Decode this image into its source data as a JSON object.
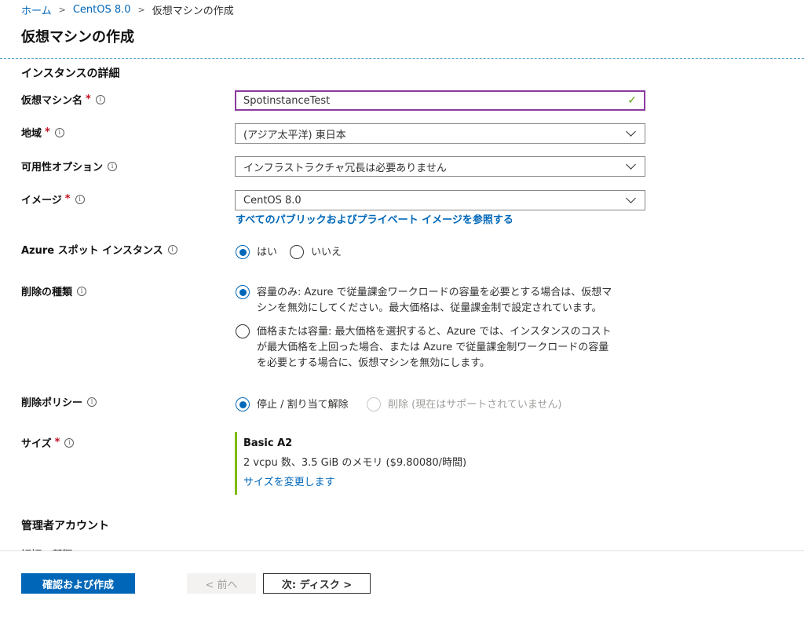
{
  "breadcrumb": {
    "home": "ホーム",
    "item2": "CentOS 8.0",
    "current": "仮想マシンの作成"
  },
  "page": {
    "title": "仮想マシンの作成"
  },
  "instance_details": {
    "heading": "インスタンスの詳細",
    "vm_name": {
      "label": "仮想マシン名",
      "value": "SpotinstanceTest"
    },
    "region": {
      "label": "地域",
      "value": "(アジア太平洋) 東日本"
    },
    "availability": {
      "label": "可用性オプション",
      "value": "インフラストラクチャ冗長は必要ありません"
    },
    "image": {
      "label": "イメージ",
      "value": "CentOS 8.0",
      "link": "すべてのパブリックおよびプライベート イメージを参照する"
    },
    "spot": {
      "label": "Azure スポット インスタンス",
      "yes": "はい",
      "no": "いいえ"
    },
    "eviction_type": {
      "label": "削除の種類",
      "option1_line1": "容量のみ: Azure で従量課金ワークロードの容量を必要とする場合は、仮想マ",
      "option1_line2": "シンを無効にしてください。最大価格は、従量課金制で設定されています。",
      "option2_line1": "価格または容量: 最大価格を選択すると、Azure では、インスタンスのコスト",
      "option2_line2": "が最大価格を上回った場合、または Azure で従量課金制ワークロードの容量",
      "option2_line3": "を必要とする場合に、仮想マシンを無効にします。"
    },
    "eviction_policy": {
      "label": "削除ポリシー",
      "stop": "停止 / 割り当て解除",
      "delete": "削除 (現在はサポートされていません)"
    },
    "size": {
      "label": "サイズ",
      "name": "Basic A2",
      "desc": "2 vcpu 数、3.5 GiB のメモリ ($9.80080/時間)",
      "link": "サイズを変更します"
    }
  },
  "admin": {
    "heading": "管理者アカウント",
    "auth_type_label": "認証の種類"
  },
  "footer": {
    "create": "確認および作成",
    "prev": "< 前へ",
    "next": "次: ディスク >"
  },
  "colors": {
    "accent": "#0067b8",
    "valid_border": "#8a3b9e",
    "size_bar": "#7fba00"
  }
}
